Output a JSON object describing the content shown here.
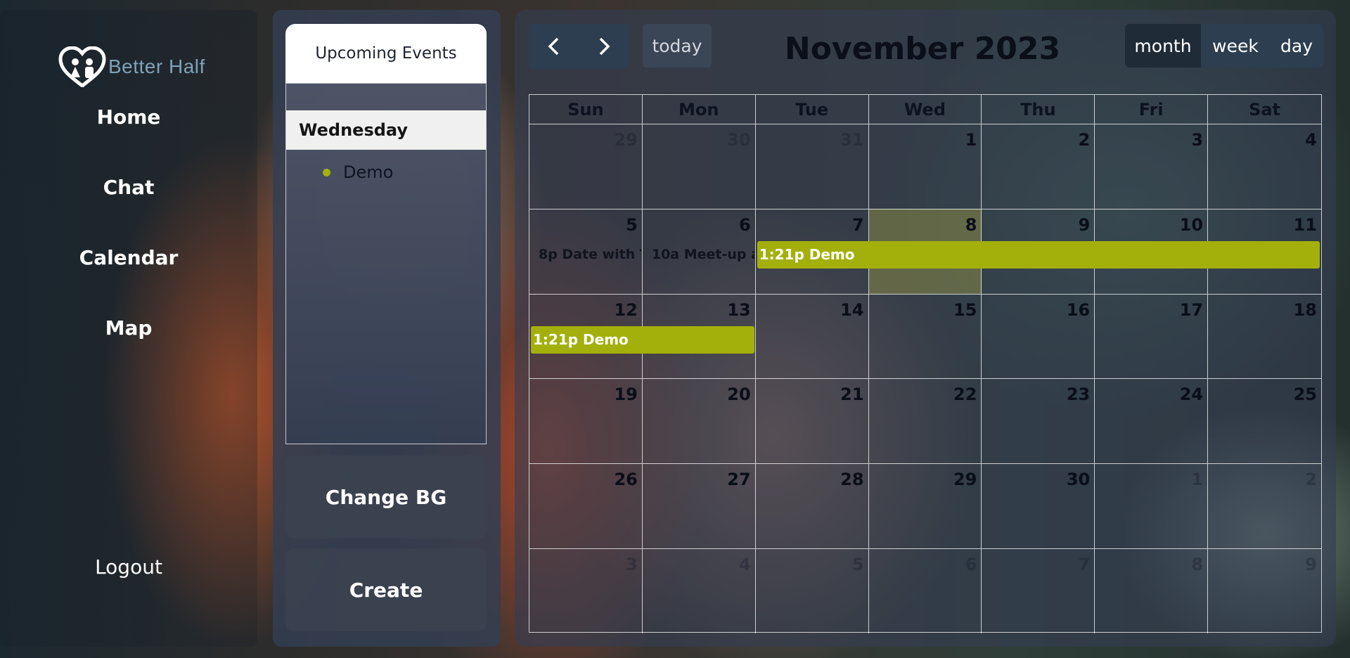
{
  "app": {
    "brand": "Better Half"
  },
  "nav": {
    "items": [
      {
        "label": "Home"
      },
      {
        "label": "Chat"
      },
      {
        "label": "Calendar"
      },
      {
        "label": "Map"
      }
    ],
    "logout": "Logout"
  },
  "upcoming": {
    "title": "Upcoming Events",
    "day": "Wednesday",
    "events": [
      {
        "label": "Demo",
        "color": "#a3b00c"
      }
    ]
  },
  "actions": {
    "change_bg": "Change BG",
    "create": "Create"
  },
  "calendar": {
    "title": "November 2023",
    "today_label": "today",
    "prev_icon": "chevron-left-icon",
    "next_icon": "chevron-right-icon",
    "views": [
      "month",
      "week",
      "day"
    ],
    "active_view": "month",
    "weekdays": [
      "Sun",
      "Mon",
      "Tue",
      "Wed",
      "Thu",
      "Fri",
      "Sat"
    ],
    "today_date": "8",
    "weeks": [
      [
        {
          "d": "29",
          "other": true
        },
        {
          "d": "30",
          "other": true
        },
        {
          "d": "31",
          "other": true
        },
        {
          "d": "1"
        },
        {
          "d": "2"
        },
        {
          "d": "3"
        },
        {
          "d": "4"
        }
      ],
      [
        {
          "d": "5"
        },
        {
          "d": "6"
        },
        {
          "d": "7"
        },
        {
          "d": "8",
          "today": true
        },
        {
          "d": "9"
        },
        {
          "d": "10"
        },
        {
          "d": "11"
        }
      ],
      [
        {
          "d": "12"
        },
        {
          "d": "13"
        },
        {
          "d": "14"
        },
        {
          "d": "15"
        },
        {
          "d": "16"
        },
        {
          "d": "17"
        },
        {
          "d": "18"
        }
      ],
      [
        {
          "d": "19"
        },
        {
          "d": "20"
        },
        {
          "d": "21"
        },
        {
          "d": "22"
        },
        {
          "d": "23"
        },
        {
          "d": "24"
        },
        {
          "d": "25"
        }
      ],
      [
        {
          "d": "26"
        },
        {
          "d": "27"
        },
        {
          "d": "28"
        },
        {
          "d": "29"
        },
        {
          "d": "30"
        },
        {
          "d": "1",
          "other": true
        },
        {
          "d": "2",
          "other": true
        }
      ],
      [
        {
          "d": "3",
          "other": true
        },
        {
          "d": "4",
          "other": true
        },
        {
          "d": "5",
          "other": true
        },
        {
          "d": "6",
          "other": true
        },
        {
          "d": "7",
          "other": true
        },
        {
          "d": "8",
          "other": true
        },
        {
          "d": "9",
          "other": true
        }
      ]
    ],
    "events": [
      {
        "kind": "dot",
        "time": "8p",
        "title": "Date with T",
        "color": "#a3b00c",
        "week": 1,
        "start": 0,
        "end": 0
      },
      {
        "kind": "dot",
        "time": "10a",
        "title": "Meet-up a",
        "color": "#f4b8c4",
        "week": 1,
        "start": 1,
        "end": 1
      },
      {
        "kind": "bar",
        "time": "1:21p",
        "title": "Demo",
        "color": "#a3b00c",
        "week": 1,
        "start": 2,
        "end": 6
      },
      {
        "kind": "bar",
        "time": "1:21p",
        "title": "Demo",
        "color": "#a3b00c",
        "week": 2,
        "start": 0,
        "end": 1
      }
    ],
    "colors": {
      "event_bar": "#a3b00c",
      "nav_button": "#2c3e50"
    }
  }
}
